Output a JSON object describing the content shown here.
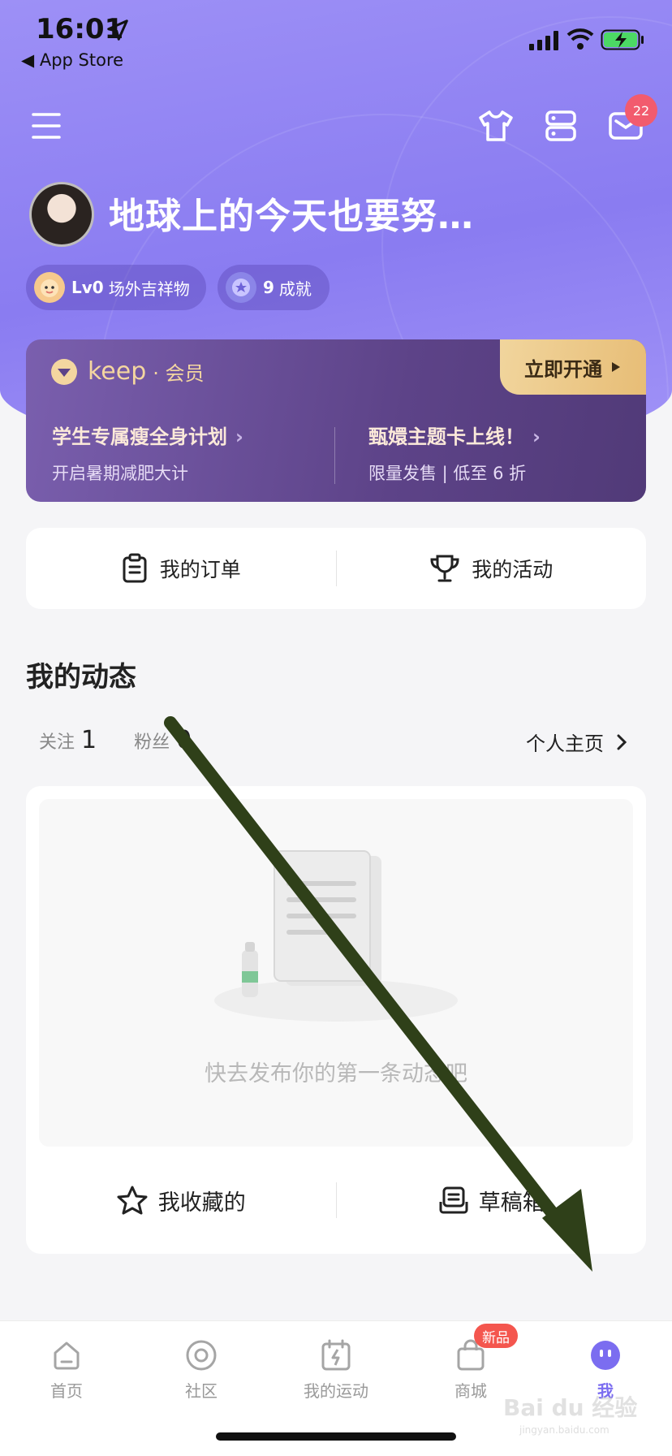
{
  "status_bar": {
    "time": "16:01",
    "back_app": "◀ App Store"
  },
  "header": {
    "mail_badge": "22"
  },
  "profile": {
    "username": "地球上的今天也要努…",
    "level_label": "Lv0",
    "level_title": "场外吉祥物",
    "achievement_count": "9",
    "achievement_label": "成就"
  },
  "member": {
    "logo": "keep",
    "tag": "· 会员",
    "cta": "立即开通",
    "promo_left_title": "学生专属瘦全身计划",
    "promo_left_sub": "开启暑期减肥大计",
    "promo_right_title": "甄嬛主题卡上线！",
    "promo_right_sub": "限量发售 | 低至 6 折"
  },
  "quick": {
    "orders": "我的订单",
    "activities": "我的活动"
  },
  "feed": {
    "section_title": "我的动态",
    "follow_label": "关注",
    "follow_count": "1",
    "fans_label": "粉丝",
    "fans_count": "0",
    "homepage_link": "个人主页",
    "empty_text": "快去发布你的第一条动态吧",
    "favorites": "我收藏的",
    "drafts": "草稿箱"
  },
  "tabbar": {
    "home": "首页",
    "community": "社区",
    "my_sport": "我的运动",
    "store": "商城",
    "store_badge": "新品",
    "me": "我"
  },
  "watermark": {
    "brand": "Bai du 经验",
    "url": "jingyan.baidu.com"
  },
  "colors": {
    "accent": "#7b6df0",
    "hero": "#8a7cf1",
    "badge": "#f25b6e",
    "gold": "#e7bd76"
  }
}
